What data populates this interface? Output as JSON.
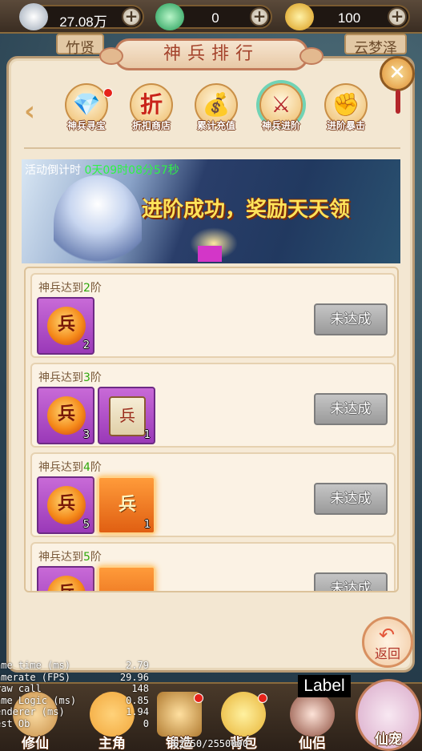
{
  "resources": [
    {
      "name": "silver",
      "value": "27.08万",
      "color": "#c9d2dd"
    },
    {
      "name": "jade",
      "value": "0",
      "color": "#3fc07a"
    },
    {
      "name": "gold",
      "value": "100",
      "color": "#f2c136"
    }
  ],
  "behind_tabs": [
    "竹贤",
    "云梦泽"
  ],
  "panel": {
    "title": "神兵排行",
    "close_icon": "close-icon"
  },
  "tabs": [
    {
      "label": "神兵寻宝",
      "icon": "treasure-icon",
      "glyph": "💎",
      "badge": true,
      "active": false
    },
    {
      "label": "折扣商店",
      "icon": "discount-shop-icon",
      "glyph": "折",
      "badge": false,
      "active": false
    },
    {
      "label": "累计充值",
      "icon": "recharge-icon",
      "glyph": "💰",
      "badge": false,
      "active": false
    },
    {
      "label": "神兵进阶",
      "icon": "weapon-advance-icon",
      "glyph": "⚔",
      "badge": false,
      "active": true
    },
    {
      "label": "进阶暴击",
      "icon": "crit-fist-icon",
      "glyph": "✊",
      "badge": false,
      "active": false
    }
  ],
  "banner": {
    "timer_label": "活动倒计时",
    "timer_value": "0天09时08分57秒",
    "slogan": "进阶成功，奖励天天领"
  },
  "rewards": [
    {
      "prefix": "神兵达到",
      "level": "2",
      "suffix": "阶",
      "status": "未达成",
      "items": [
        {
          "type": "gem",
          "glyph": "兵",
          "count": "2"
        }
      ]
    },
    {
      "prefix": "神兵达到",
      "level": "3",
      "suffix": "阶",
      "status": "未达成",
      "items": [
        {
          "type": "gem",
          "glyph": "兵",
          "count": "3"
        },
        {
          "type": "scroll",
          "glyph": "兵",
          "count": "1"
        }
      ]
    },
    {
      "prefix": "神兵达到",
      "level": "4",
      "suffix": "阶",
      "status": "未达成",
      "items": [
        {
          "type": "gem",
          "glyph": "兵",
          "count": "5"
        },
        {
          "type": "weapon",
          "glyph": "兵",
          "count": "1"
        }
      ]
    },
    {
      "prefix": "神兵达到",
      "level": "5",
      "suffix": "阶",
      "status": "未达成",
      "items": [
        {
          "type": "gem",
          "glyph": "兵",
          "count": ""
        },
        {
          "type": "weapon",
          "glyph": "",
          "count": ""
        }
      ]
    }
  ],
  "back_button": "返回",
  "debug_label": "Label",
  "stats": [
    {
      "key": "ame time (ms)",
      "value": "2.79"
    },
    {
      "key": "amerate (FPS)",
      "value": "29.96"
    },
    {
      "key": "raw call",
      "value": "148"
    },
    {
      "key": "ame Logic (ms)",
      "value": "0.85"
    },
    {
      "key": "enderer (ms)",
      "value": "1.94"
    },
    {
      "key": "est Ob",
      "value": "0"
    }
  ],
  "coin_progress": "62750/2550000",
  "bottom_nav": [
    {
      "label": "修仙",
      "icon": "cultivate-icon",
      "color": "#c98f47",
      "badge": false
    },
    {
      "label": "主角",
      "icon": "hero-icon",
      "color": "#f1a63a",
      "badge": false
    },
    {
      "label": "锻造",
      "icon": "forge-icon",
      "color": "#e0a040",
      "badge": true
    },
    {
      "label": "背包",
      "icon": "bag-icon",
      "color": "#e7b234",
      "badge": true
    },
    {
      "label": "仙侣",
      "icon": "companion-icon",
      "color": "#d98c7a",
      "badge": false
    },
    {
      "label": "仙宠",
      "icon": "pet-icon",
      "color": "#e9c0d8",
      "badge": false
    }
  ]
}
